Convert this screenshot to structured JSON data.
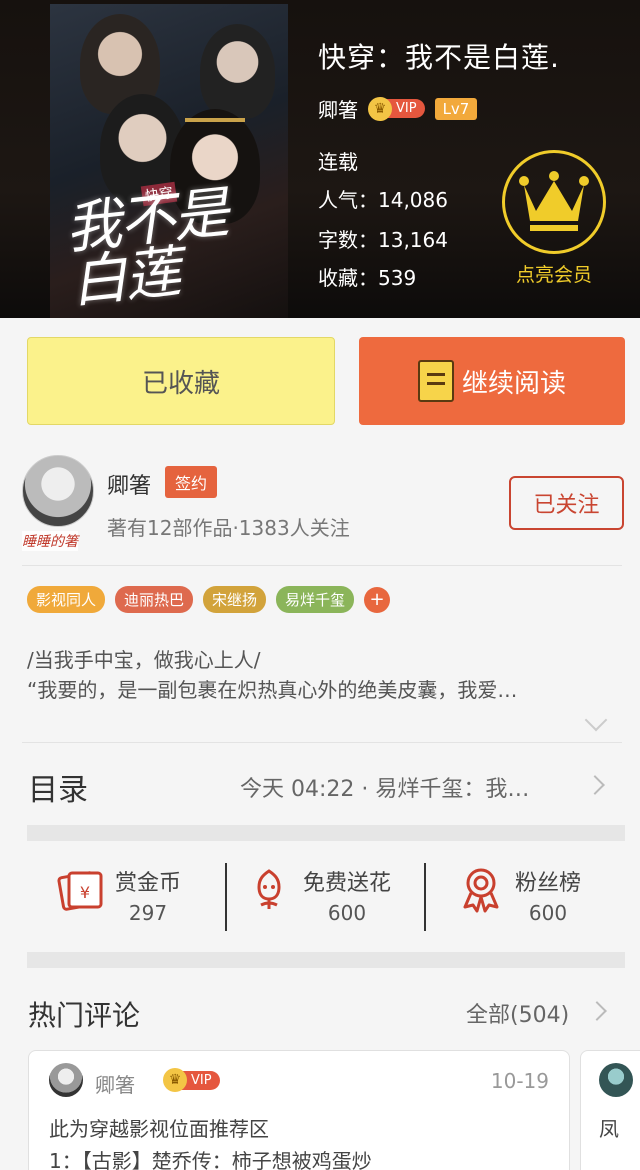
{
  "header": {
    "cover_title": "我不是白莲",
    "cover_tag": "快穿",
    "book_title": "快穿：我不是白莲.",
    "author": "卿箸",
    "vip_label": "VIP",
    "level": "Lv7",
    "status": "连载",
    "popularity": "人气：14,086",
    "word_count": "字数：13,164",
    "favorites": "收藏：539",
    "member_label": "点亮会员"
  },
  "actions": {
    "favorited_label": "已收藏",
    "continue_label": "继续阅读"
  },
  "author_info": {
    "name": "卿箸",
    "signature_text": "睡睡的箸",
    "signed_badge": "签约",
    "meta": "著有12部作品·1383人关注",
    "follow_label": "已关注"
  },
  "tags": [
    {
      "label": "影视同人",
      "color": "#f0a93a"
    },
    {
      "label": "迪丽热巴",
      "color": "#de6a4e"
    },
    {
      "label": "宋继扬",
      "color": "#d2a33b"
    },
    {
      "label": "易烊千玺",
      "color": "#8bb55a"
    }
  ],
  "tag_add": "+",
  "intro": {
    "line1": "/当我手中宝，做我心上人/",
    "line2": "“我要的，是一副包裹在炽热真心外的绝美皮囊，我爱…"
  },
  "toc": {
    "title": "目录",
    "latest": "今天 04:22 · 易烊千玺：我…"
  },
  "stats": [
    {
      "label": "赏金币",
      "value": "297",
      "icon": "red-envelope-icon"
    },
    {
      "label": "免费送花",
      "value": "600",
      "icon": "flower-icon"
    },
    {
      "label": "粉丝榜",
      "value": "600",
      "icon": "medal-icon"
    }
  ],
  "hot_comments": {
    "title": "热门评论",
    "all_label": "全部(504)",
    "comment": {
      "user": "卿箸",
      "vip": "VIP",
      "date": "10-19",
      "line1": "此为穿越影视位面推荐区",
      "line2": "1：【古影】楚乔传：柿子想被鸡蛋炒"
    },
    "comment2_preview": "凤"
  },
  "colors": {
    "accent_orange": "#ee6a3e",
    "favorite_yellow": "#fbf28b",
    "member_gold": "#f0cc2a",
    "follow_red": "#c94531"
  }
}
